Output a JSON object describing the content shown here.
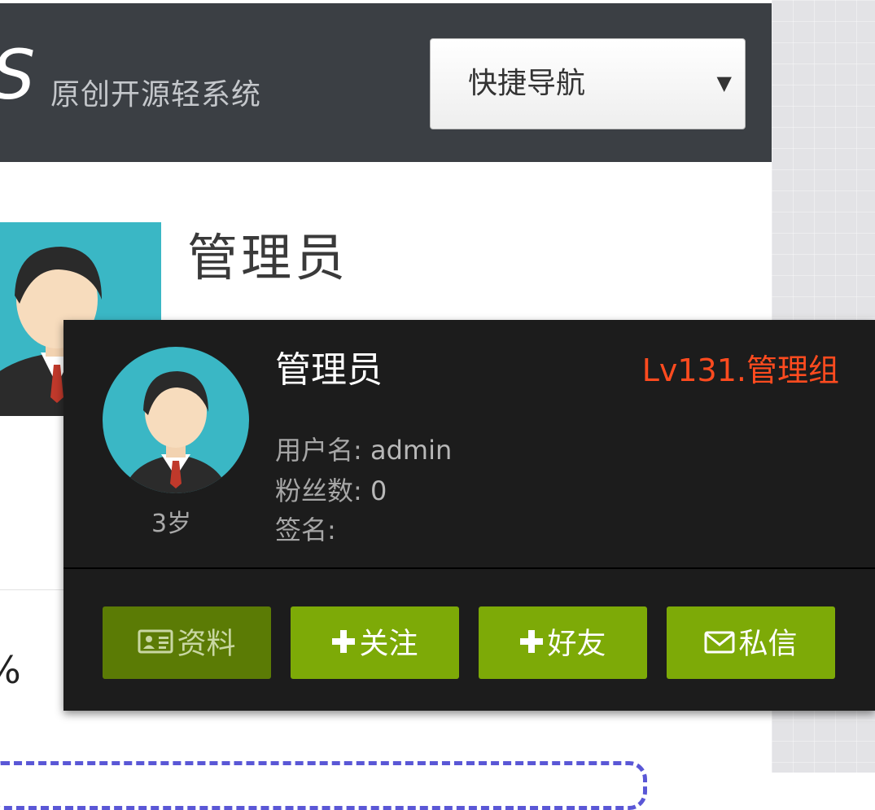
{
  "header": {
    "logo_letter": "S",
    "logo_tagline": "原创开源轻系统",
    "nav_select": {
      "value": "快捷导航",
      "arrow": "▼"
    }
  },
  "profile": {
    "name": "管理员",
    "left_char": "%"
  },
  "user_card": {
    "name": "管理员",
    "level": "Lv131.管理组",
    "age": "3岁",
    "fields": [
      {
        "label": "用户名:",
        "value": "admin"
      },
      {
        "label": "粉丝数:",
        "value": "0"
      },
      {
        "label": "签名:",
        "value": ""
      }
    ],
    "buttons": [
      {
        "label": "资料",
        "icon": "id-card-icon"
      },
      {
        "label": "关注",
        "icon": "plus-icon"
      },
      {
        "label": "好友",
        "icon": "plus-icon"
      },
      {
        "label": "私信",
        "icon": "envelope-icon"
      }
    ]
  },
  "colors": {
    "header_bg": "#3b3f44",
    "avatar_bg": "#3ab7c5",
    "card_bg": "#1c1c1c",
    "level_red": "#ff4b1f",
    "button_green": "#7daa07",
    "button_green_dark": "#5b7b05",
    "dashed_border": "#5a57d6"
  }
}
